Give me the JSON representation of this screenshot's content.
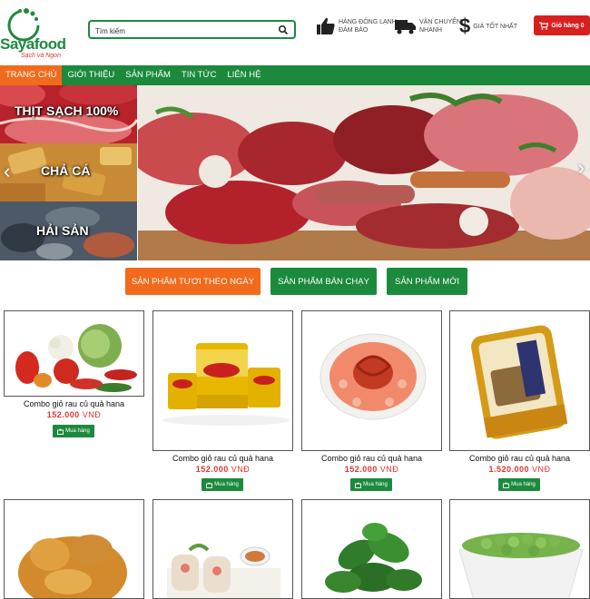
{
  "brand": {
    "name": "Sayafood",
    "slogan": "Sạch và Ngon"
  },
  "search": {
    "placeholder": "Tìm kiếm"
  },
  "features": [
    {
      "icon": "thumbs-up-icon",
      "line1": "HÀNG ĐÔNG LẠNH",
      "line2": "ĐẢM BẢO"
    },
    {
      "icon": "truck-icon",
      "line1": "VẬN CHUYỂN",
      "line2": "NHANH"
    },
    {
      "icon": "dollar-icon",
      "line1": "GIÁ TỐT NHẤT",
      "line2": ""
    }
  ],
  "cart": {
    "label": "Giỏ hàng 0"
  },
  "nav": [
    {
      "label": "TRANG CHỦ",
      "active": true
    },
    {
      "label": "GIỚI THIỆU",
      "active": false
    },
    {
      "label": "SẢN PHẨM",
      "active": false
    },
    {
      "label": "TIN TỨC",
      "active": false
    },
    {
      "label": "LIÊN HỆ",
      "active": false
    }
  ],
  "banner": {
    "side": [
      {
        "label": "THỊT SẠCH 100%"
      },
      {
        "label": "CHẢ CÁ"
      },
      {
        "label": "HẢI SẢN"
      }
    ]
  },
  "tabs": [
    {
      "label": "SẢN PHẨM TƯƠI THEO NGÀY",
      "color": "#f26a1b"
    },
    {
      "label": "SẢN PHẨM BÁN CHẠY",
      "color": "#1c8a3c"
    },
    {
      "label": "SẢN PHẨM MỚI",
      "color": "#1c8a3c"
    }
  ],
  "products": [
    {
      "name": "Combo giỏ rau củ quả hana",
      "price": "152.000",
      "currency": "VNĐ",
      "buy": "Mua hàng",
      "image": "vegetables"
    },
    {
      "name": "Combo giỏ rau củ quả hana",
      "price": "152.000",
      "currency": "VNĐ",
      "buy": "Mua hàng",
      "image": "fiesta-cans"
    },
    {
      "name": "Combo giỏ rau củ quả hana",
      "price": "152.000",
      "currency": "VNĐ",
      "buy": "Mua hàng",
      "image": "tomato-plate"
    },
    {
      "name": "Combo giỏ rau củ quả hana",
      "price": "1.520.000",
      "currency": "VNĐ",
      "buy": "Mua hàng",
      "image": "canned-fish"
    },
    {
      "image": "fried-chicken"
    },
    {
      "image": "spring-rolls"
    },
    {
      "image": "spinach"
    },
    {
      "image": "green-peas"
    }
  ]
}
